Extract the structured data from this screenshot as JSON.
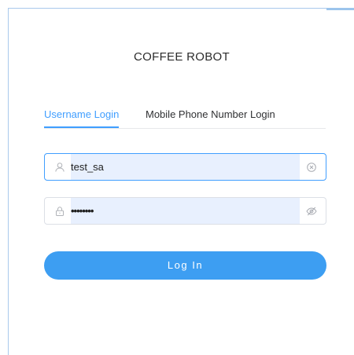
{
  "app": {
    "title": "COFFEE ROBOT"
  },
  "tabs": {
    "username_login": "Username Login",
    "mobile_login": "Mobile Phone Number Login",
    "active": "username_login"
  },
  "form": {
    "username": {
      "value": "test_sa",
      "icon": "user-icon",
      "action_icon": "clear-icon"
    },
    "password": {
      "value": "••••••••",
      "icon": "lock-icon",
      "action_icon": "eye-hidden-icon"
    },
    "login_button": "Log In"
  },
  "colors": {
    "accent": "#409eff",
    "button": "#3d9ef2",
    "autofill": "#e8f0fe"
  }
}
